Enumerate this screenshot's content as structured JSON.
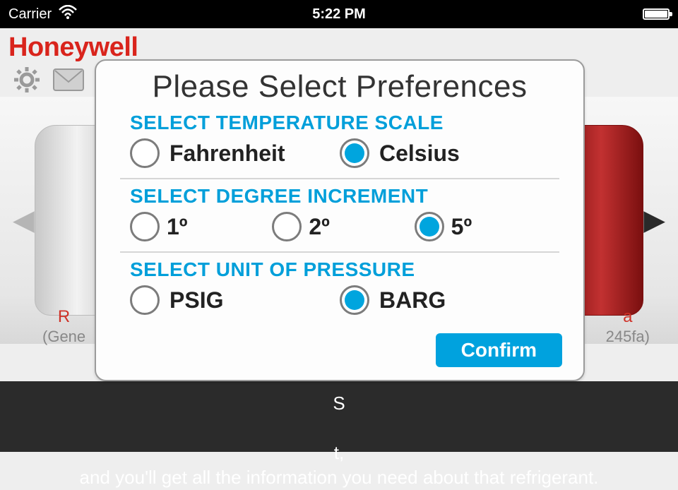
{
  "status_bar": {
    "carrier": "Carrier",
    "time": "5:22 PM"
  },
  "brand": "Honeywell",
  "bottom_instructions_line1": "S",
  "bottom_instructions_line2": "and you'll get all the information you need about that refrigerant.",
  "bottom_trailing": "t,",
  "captions": {
    "left_title": "R",
    "left_sub": "(Gene",
    "right_title": "a",
    "right_sub": "245fa)"
  },
  "modal": {
    "title": "Please Select Preferences",
    "sections": {
      "temperature": {
        "label": "SELECT TEMPERATURE SCALE",
        "options": [
          {
            "label": "Fahrenheit",
            "selected": false
          },
          {
            "label": "Celsius",
            "selected": true
          }
        ]
      },
      "increment": {
        "label": "SELECT DEGREE INCREMENT",
        "options": [
          {
            "label": "1º",
            "selected": false
          },
          {
            "label": "2º",
            "selected": false
          },
          {
            "label": "5º",
            "selected": true
          }
        ]
      },
      "pressure": {
        "label": "SELECT UNIT OF PRESSURE",
        "options": [
          {
            "label": "PSIG",
            "selected": false
          },
          {
            "label": "BARG",
            "selected": true
          }
        ]
      }
    },
    "confirm_label": "Confirm"
  }
}
